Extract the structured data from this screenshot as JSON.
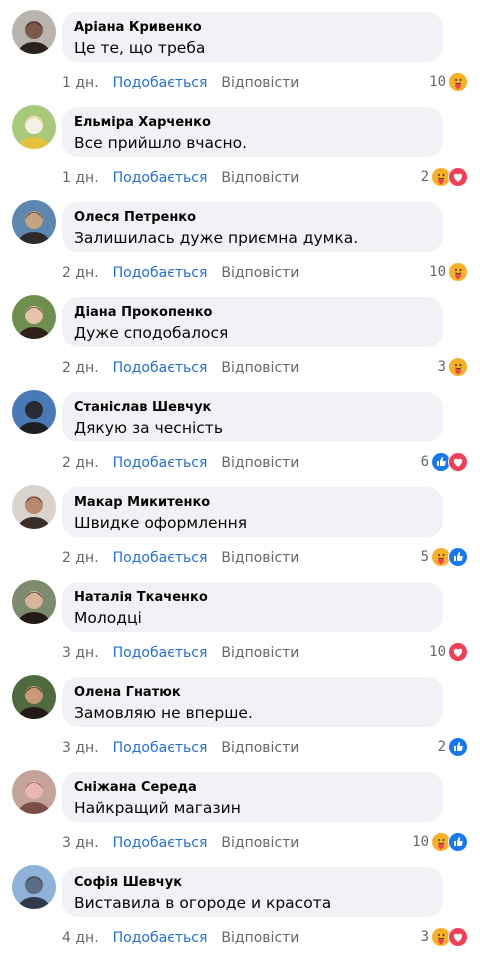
{
  "labels": {
    "like": "Подобається",
    "reply": "Відповісти"
  },
  "comments": [
    {
      "author": "Аріана Кривенко",
      "text": "Це те, що треба",
      "time": "1 дн.",
      "count": "10",
      "reactions": [
        "care"
      ],
      "avatar": {
        "bg": "#b9b4ae",
        "face": "#7a5a4a",
        "hair": "#2b211c"
      }
    },
    {
      "author": "Ельміра Харченко",
      "text": "Все прийшло вчасно.",
      "time": "1 дн.",
      "count": "2",
      "reactions": [
        "care",
        "love"
      ],
      "avatar": {
        "bg": "#a9c97a",
        "face": "#f3f0e6",
        "hair": "#e2c23a"
      }
    },
    {
      "author": "Олеся Петренко",
      "text": "Залишилась дуже приємна думка.",
      "time": "2 дн.",
      "count": "10",
      "reactions": [
        "care"
      ],
      "avatar": {
        "bg": "#5d86b0",
        "face": "#c7a27e",
        "hair": "#2e2a2a"
      }
    },
    {
      "author": "Діана Прокопенко",
      "text": "Дуже сподобалося",
      "time": "2 дн.",
      "count": "3",
      "reactions": [
        "care"
      ],
      "avatar": {
        "bg": "#6f8f4e",
        "face": "#e6c3a8",
        "hair": "#2d2119"
      }
    },
    {
      "author": "Станіслав Шевчук",
      "text": "Дякую за чесність",
      "time": "2 дн.",
      "count": "6",
      "reactions": [
        "like",
        "love"
      ],
      "avatar": {
        "bg": "#4a79b8",
        "face": "#2b2b33",
        "hair": "#1d1d22"
      }
    },
    {
      "author": "Макар Микитенко",
      "text": "Швидке оформлення",
      "time": "2 дн.",
      "count": "5",
      "reactions": [
        "care",
        "like"
      ],
      "avatar": {
        "bg": "#d9d3cc",
        "face": "#b58a6f",
        "hair": "#3a2e28"
      }
    },
    {
      "author": "Наталія Ткаченко",
      "text": "Молодці",
      "time": "3 дн.",
      "count": "10",
      "reactions": [
        "love"
      ],
      "avatar": {
        "bg": "#7c8a6e",
        "face": "#d7b59a",
        "hair": "#211a16"
      }
    },
    {
      "author": "Олена Гнатюк",
      "text": "Замовляю не вперше.",
      "time": "3 дн.",
      "count": "2",
      "reactions": [
        "like"
      ],
      "avatar": {
        "bg": "#4f6a3c",
        "face": "#c99a7a",
        "hair": "#241b16"
      }
    },
    {
      "author": "Сніжана Середа",
      "text": "Найкращий магазин",
      "time": "3 дн.",
      "count": "10",
      "reactions": [
        "care",
        "like"
      ],
      "avatar": {
        "bg": "#c4a39b",
        "face": "#e8b7b0",
        "hair": "#7b4e47"
      }
    },
    {
      "author": "Софія Шевчук",
      "text": "Виставила в огороде и красота",
      "time": "4 дн.",
      "count": "3",
      "reactions": [
        "care",
        "love"
      ],
      "avatar": {
        "bg": "#8fb3d8",
        "face": "#5a6d82",
        "hair": "#2f3b4a"
      }
    }
  ],
  "reaction_colors": {
    "like": "#1877f2",
    "love": "#f33e58",
    "care": "#f7b125"
  }
}
